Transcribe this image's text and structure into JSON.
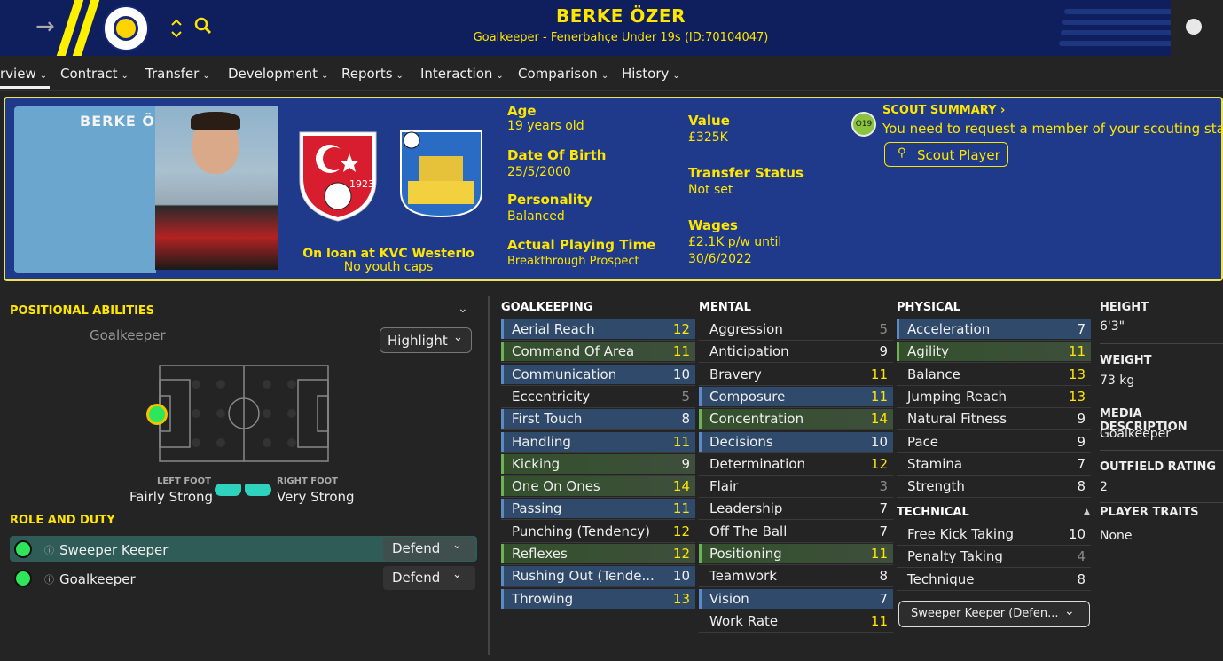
{
  "header": {
    "player_name": "BERKE ÖZER",
    "subtitle": "Goalkeeper - Fenerbahçe Under 19s (ID:70104047)",
    "back_icon": "arrow-right-icon",
    "sort_icon": "up-down-chevron-icon",
    "search_icon": "search-icon",
    "globe_icon": "globe-icon"
  },
  "tabs": [
    {
      "label": "rview"
    },
    {
      "label": "Contract"
    },
    {
      "label": "Transfer"
    },
    {
      "label": "Development"
    },
    {
      "label": "Reports"
    },
    {
      "label": "Interaction"
    },
    {
      "label": "Comparison"
    },
    {
      "label": "History"
    }
  ],
  "card": {
    "name_label": "BERKE Ö",
    "loan_text": "On loan at KVC Westerlo",
    "caps_text": "No youth caps",
    "age_label": "Age",
    "age_value": "19 years old",
    "dob_label": "Date Of Birth",
    "dob_value": "25/5/2000",
    "personality_label": "Personality",
    "personality_value": "Balanced",
    "playing_time_label": "Actual Playing Time",
    "playing_time_value": "Breakthrough Prospect",
    "value_label": "Value",
    "value_value": "£325K",
    "transfer_status_label": "Transfer Status",
    "transfer_status_value": "Not set",
    "wages_label": "Wages",
    "wages_value_1": "£2.1K p/w until",
    "wages_value_2": "30/6/2022",
    "scout_badge": "O19",
    "scout_title": "SCOUT SUMMARY",
    "scout_text": "You need to request a member of your scouting staff",
    "scout_button": "Scout Player",
    "flag_year": "1923"
  },
  "positional": {
    "title": "POSITIONAL ABILITIES",
    "position": "Goalkeeper",
    "highlight": "Highlight",
    "left_foot_label": "LEFT FOOT",
    "left_foot_value": "Fairly Strong",
    "right_foot_label": "RIGHT FOOT",
    "right_foot_value": "Very Strong"
  },
  "role": {
    "title": "ROLE AND DUTY",
    "rows": [
      {
        "role": "Sweeper Keeper",
        "duty": "Defend"
      },
      {
        "role": "Goalkeeper",
        "duty": "Defend"
      }
    ]
  },
  "goalkeeping": {
    "title": "GOALKEEPING",
    "attrs": [
      {
        "name": "Aerial Reach",
        "value": "12"
      },
      {
        "name": "Command Of Area",
        "value": "11"
      },
      {
        "name": "Communication",
        "value": "10"
      },
      {
        "name": "Eccentricity",
        "value": "5"
      },
      {
        "name": "First Touch",
        "value": "8"
      },
      {
        "name": "Handling",
        "value": "11"
      },
      {
        "name": "Kicking",
        "value": "9"
      },
      {
        "name": "One On Ones",
        "value": "14"
      },
      {
        "name": "Passing",
        "value": "11"
      },
      {
        "name": "Punching (Tendency)",
        "value": "12"
      },
      {
        "name": "Reflexes",
        "value": "12"
      },
      {
        "name": "Rushing Out (Tende...",
        "value": "10"
      },
      {
        "name": "Throwing",
        "value": "13"
      }
    ]
  },
  "mental": {
    "title": "MENTAL",
    "attrs": [
      {
        "name": "Aggression",
        "value": "5"
      },
      {
        "name": "Anticipation",
        "value": "9"
      },
      {
        "name": "Bravery",
        "value": "11"
      },
      {
        "name": "Composure",
        "value": "11"
      },
      {
        "name": "Concentration",
        "value": "14"
      },
      {
        "name": "Decisions",
        "value": "10"
      },
      {
        "name": "Determination",
        "value": "12"
      },
      {
        "name": "Flair",
        "value": "3"
      },
      {
        "name": "Leadership",
        "value": "7"
      },
      {
        "name": "Off The Ball",
        "value": "7"
      },
      {
        "name": "Positioning",
        "value": "11"
      },
      {
        "name": "Teamwork",
        "value": "8"
      },
      {
        "name": "Vision",
        "value": "7"
      },
      {
        "name": "Work Rate",
        "value": "11"
      }
    ]
  },
  "physical": {
    "title": "PHYSICAL",
    "attrs": [
      {
        "name": "Acceleration",
        "value": "7"
      },
      {
        "name": "Agility",
        "value": "11"
      },
      {
        "name": "Balance",
        "value": "13"
      },
      {
        "name": "Jumping Reach",
        "value": "13"
      },
      {
        "name": "Natural Fitness",
        "value": "9"
      },
      {
        "name": "Pace",
        "value": "9"
      },
      {
        "name": "Stamina",
        "value": "7"
      },
      {
        "name": "Strength",
        "value": "8"
      }
    ]
  },
  "technical": {
    "title": "TECHNICAL",
    "attrs": [
      {
        "name": "Free Kick Taking",
        "value": "10"
      },
      {
        "name": "Penalty Taking",
        "value": "4"
      },
      {
        "name": "Technique",
        "value": "8"
      }
    ],
    "role_select": "Sweeper Keeper (Defen..."
  },
  "side": {
    "height_label": "HEIGHT",
    "height_value": "6'3\"",
    "weight_label": "WEIGHT",
    "weight_value": "73 kg",
    "media_label": "MEDIA DESCRIPTION",
    "media_value": "Goalkeeper",
    "outfield_label": "OUTFIELD RATING",
    "outfield_value": "2",
    "traits_label": "PLAYER TRAITS",
    "traits_value": "None"
  },
  "colors": {
    "accent": "#ffe600",
    "header_bg": "#0f1e5c",
    "card_bg": "#1f3a8a",
    "highlight_blue": "#2f4a6b",
    "highlight_green": "#3a5232"
  }
}
